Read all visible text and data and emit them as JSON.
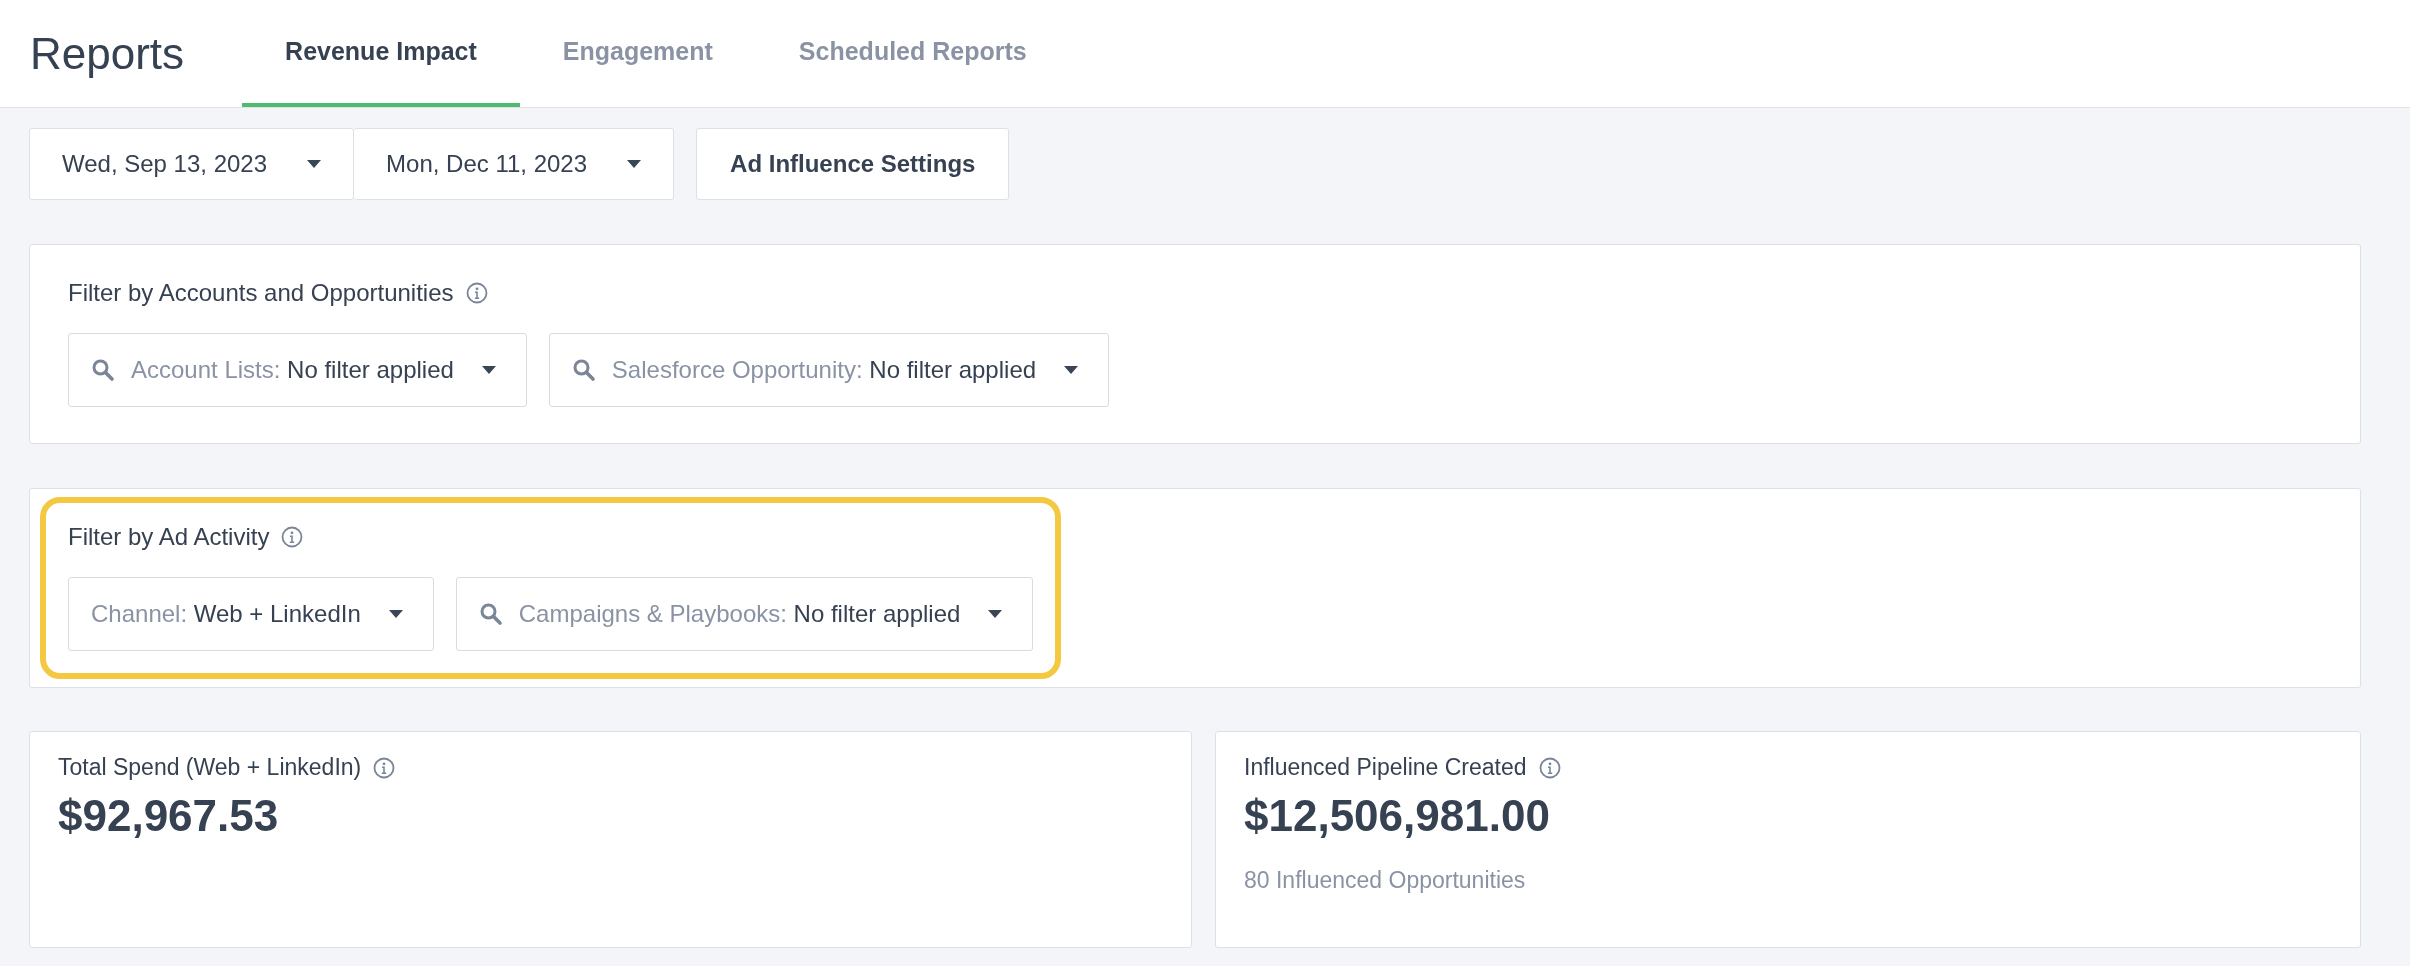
{
  "header": {
    "title": "Reports",
    "tabs": [
      {
        "label": "Revenue Impact",
        "selected": true
      },
      {
        "label": "Engagement",
        "selected": false
      },
      {
        "label": "Scheduled Reports",
        "selected": false
      }
    ]
  },
  "toolbar": {
    "dates": [
      "Wed, Sep 13, 2023",
      "Mon, Dec 11, 2023"
    ],
    "settings_button": "Ad Influence Settings"
  },
  "filter_sections": [
    {
      "title": "Filter by Accounts and Opportunities",
      "highlighted": false,
      "filters": [
        {
          "label": "Account Lists:",
          "value": "No filter applied",
          "searchable": true
        },
        {
          "label": "Salesforce Opportunity:",
          "value": "No filter applied",
          "searchable": true
        }
      ]
    },
    {
      "title": "Filter by Ad Activity",
      "highlighted": true,
      "filters": [
        {
          "label": "Channel:",
          "value": "Web + LinkedIn",
          "searchable": false
        },
        {
          "label": "Campaigns & Playbooks:",
          "value": "No filter applied",
          "searchable": true
        }
      ]
    }
  ],
  "stats": [
    {
      "title": "Total Spend (Web + LinkedIn)",
      "value": "$92,967.53"
    },
    {
      "title": "Influenced Pipeline Created",
      "value": "$12,506,981.00",
      "note": "80 Influenced Opportunities"
    }
  ]
}
